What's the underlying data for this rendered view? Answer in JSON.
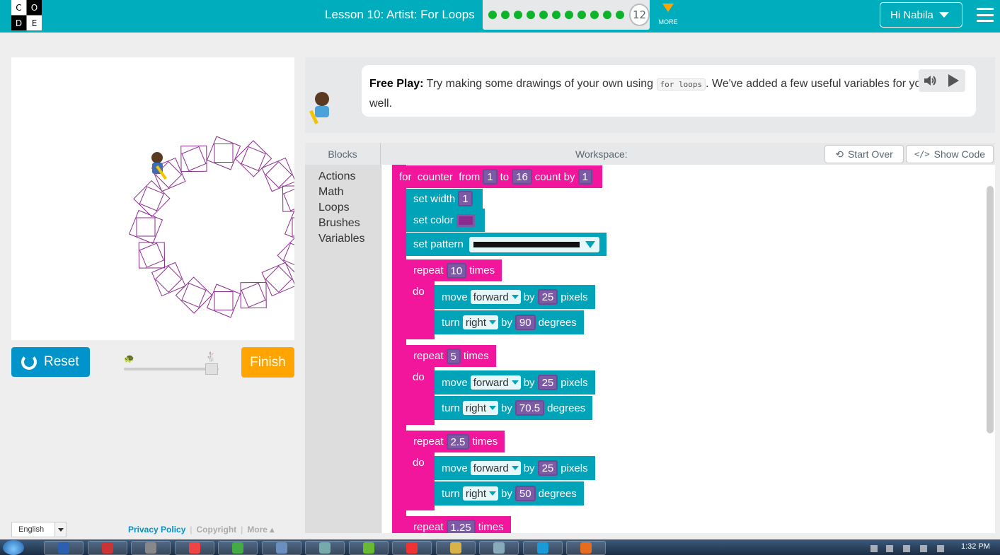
{
  "header": {
    "logo_letters": [
      "C",
      "O",
      "D",
      "E"
    ],
    "lesson_title": "Lesson 10: Artist: For Loops",
    "progress_dots": 11,
    "current_level": "12",
    "more_label": "MORE",
    "user_greeting": "Hi Nabila",
    "accent_color": "#00adbc"
  },
  "controls": {
    "reset_label": "Reset",
    "finish_label": "Finish",
    "speed_level": 0.9
  },
  "footer": {
    "language": "English",
    "privacy_policy": "Privacy Policy",
    "copyright": "Copyright",
    "more": "More ▴"
  },
  "instructions": {
    "title": "Free Play:",
    "text_before_code": " Try making some drawings of your own using ",
    "code": "for loops",
    "text_after_code": ". We've added a few useful variables for you as well."
  },
  "workspace_header": {
    "toolbox_title": "Blocks",
    "workspace_title": "Workspace:",
    "start_over": "Start Over",
    "show_code": "Show Code"
  },
  "toolbox": {
    "categories": [
      "Actions",
      "Math",
      "Loops",
      "Brushes",
      "Variables"
    ]
  },
  "blocks": {
    "for_loop": {
      "label_for": "for",
      "var": "counter",
      "label_from": "from",
      "from": "1",
      "label_to": "to",
      "to": "16",
      "label_count_by": "count by",
      "count_by": "1"
    },
    "set_width": {
      "label": "set width",
      "value": "1"
    },
    "set_color": {
      "label": "set color",
      "color": "#8b2b8f"
    },
    "set_pattern": {
      "label": "set pattern"
    },
    "repeats": [
      {
        "label": "repeat",
        "times": "10",
        "times_label": "times",
        "do_label": "do",
        "move_label": "move",
        "direction": "forward",
        "by_label": "by",
        "distance": "25",
        "pixels_label": "pixels",
        "turn_label": "turn",
        "turn_dir": "right",
        "angle": "90",
        "degrees_label": "degrees"
      },
      {
        "label": "repeat",
        "times": "5",
        "times_label": "times",
        "do_label": "do",
        "move_label": "move",
        "direction": "forward",
        "by_label": "by",
        "distance": "25",
        "pixels_label": "pixels",
        "turn_label": "turn",
        "turn_dir": "right",
        "angle": "70.5",
        "degrees_label": "degrees"
      },
      {
        "label": "repeat",
        "times": "2.5",
        "times_label": "times",
        "do_label": "do",
        "move_label": "move",
        "direction": "forward",
        "by_label": "by",
        "distance": "25",
        "pixels_label": "pixels",
        "turn_label": "turn",
        "turn_dir": "right",
        "angle": "50",
        "degrees_label": "degrees"
      },
      {
        "label": "repeat",
        "times": "1.25",
        "times_label": "times"
      }
    ]
  },
  "taskbar": {
    "clock": "1:32 PM",
    "apps": [
      "word",
      "paint",
      "clock",
      "pen",
      "tool",
      "window",
      "cube",
      "android",
      "chrome",
      "folder",
      "explorer",
      "skype",
      "firefox"
    ]
  }
}
